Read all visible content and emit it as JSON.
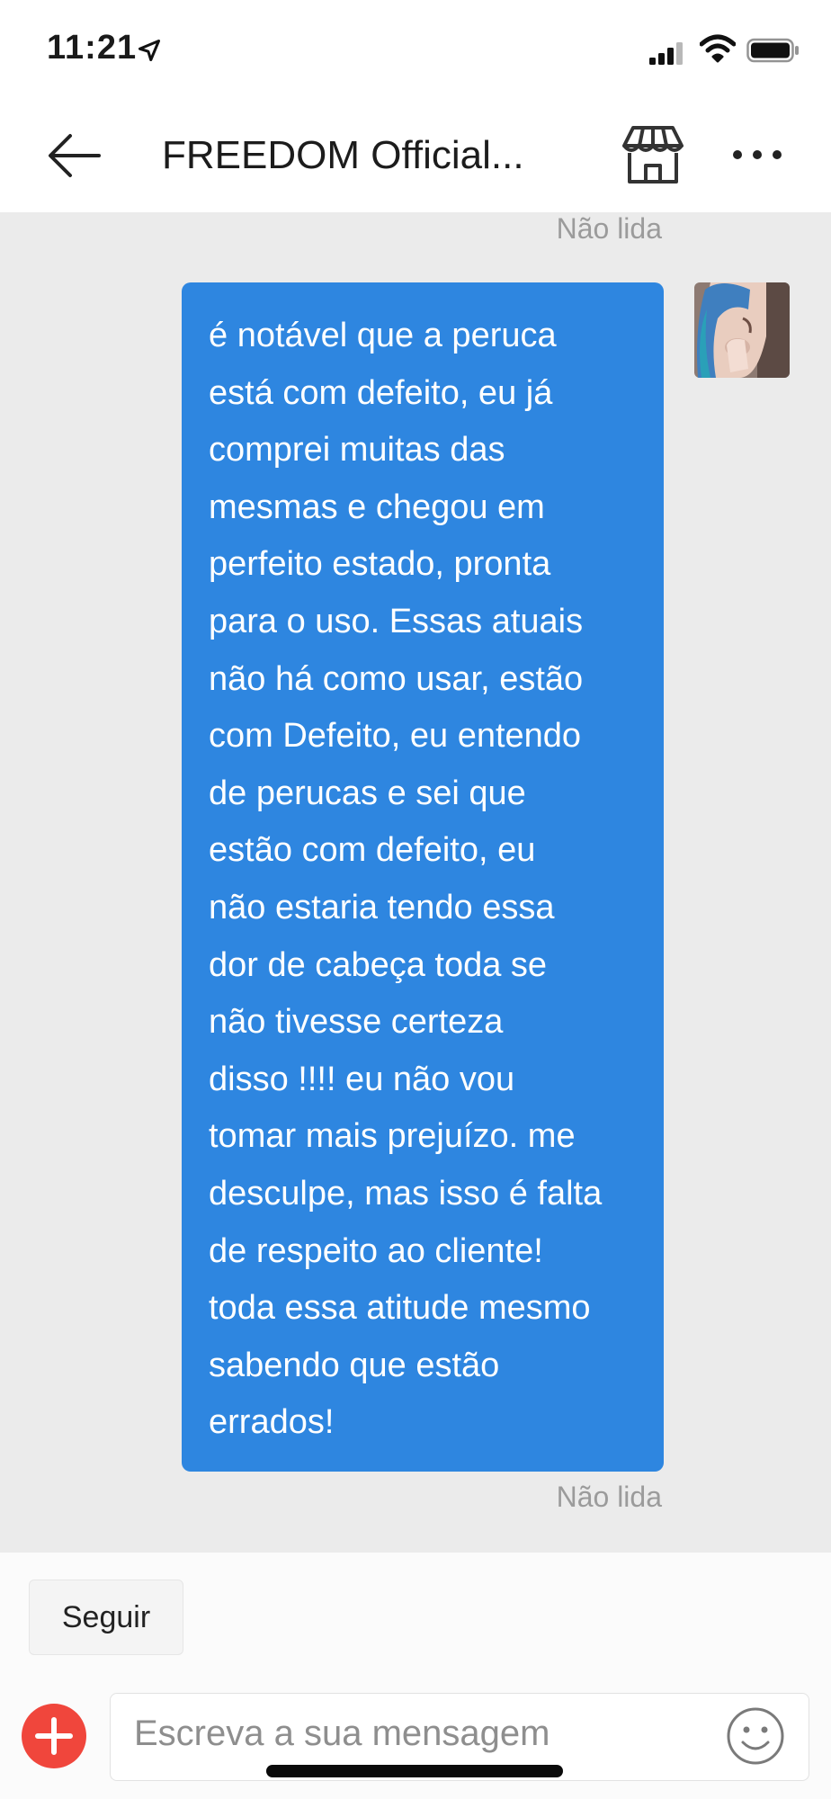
{
  "status_bar": {
    "time": "11:21"
  },
  "header": {
    "title": "FREEDOM Official..."
  },
  "messages": [
    {
      "sender": "me",
      "read_status_above": "Não lida",
      "lines": [
        "é notável que a peruca",
        "está com defeito, eu já",
        "comprei muitas das",
        "mesmas e chegou em",
        "perfeito estado, pronta",
        "para o uso. Essas atuais",
        "não há como usar, estão",
        "com Defeito, eu entendo",
        "de perucas e sei que",
        "estão com defeito, eu",
        "não estaria tendo essa",
        "dor de cabeça toda se",
        "não tivesse certeza",
        "disso !!!! eu não vou",
        "tomar mais prejuízo. me",
        "desculpe, mas isso é falta",
        "de respeito ao cliente!",
        "toda essa atitude mesmo",
        "sabendo que estão",
        "errados!"
      ],
      "read_status": "Não lida"
    }
  ],
  "actions": {
    "follow_label": "Seguir"
  },
  "composer": {
    "placeholder": "Escreva a sua mensagem"
  },
  "colors": {
    "bubble": "#2e86e0",
    "add_button": "#f0463c",
    "chat_background": "#ebebeb"
  }
}
